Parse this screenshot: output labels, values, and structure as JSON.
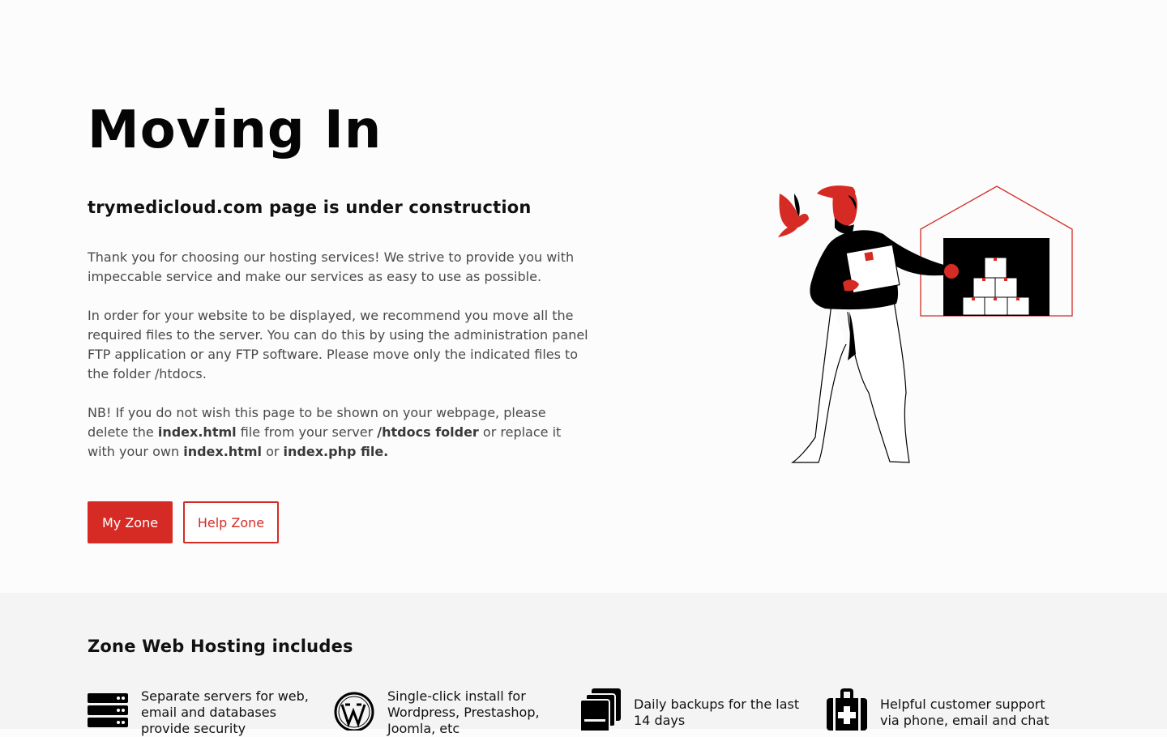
{
  "hero": {
    "title": "Moving In",
    "subtitle": "trymedicloud.com page is under construction",
    "paragraph1": "Thank you for choosing our hosting services! We strive to provide you with impeccable service and make our services as easy to use as possible.",
    "paragraph2": "In order for your website to be displayed, we recommend you move all the required files to the server. You can do this by using the administration panel FTP application or any FTP software. Please move only the indicated files to the folder /htdocs.",
    "paragraph3": {
      "part1": "NB! If you do not wish this page to be shown on your webpage, please delete the ",
      "bold1": "index.html",
      "part2": " file from your server ",
      "bold2": "/htdocs folder",
      "part3": " or replace it with your own ",
      "bold3": "index.html",
      "part4": " or ",
      "bold4": "index.php file."
    },
    "buttons": {
      "primary_label": "My Zone",
      "secondary_label": "Help Zone"
    },
    "illustration_icon": "mover-with-box-warehouse-illustration"
  },
  "features": {
    "title": "Zone Web Hosting includes",
    "items": [
      {
        "icon": "server-stack-icon",
        "text": "Separate servers for web, email and databases provide security"
      },
      {
        "icon": "wordpress-icon",
        "text": "Single-click install for Wordpress, Prestashop, Joomla, etc"
      },
      {
        "icon": "backup-copies-icon",
        "text": "Daily backups for the last 14 days"
      },
      {
        "icon": "first-aid-kit-icon",
        "text": "Helpful customer support via phone, email and chat"
      }
    ]
  },
  "colors": {
    "accent": "#d52b24",
    "features_bg": "#f4f4f4",
    "page_bg": "#fcfcfc"
  }
}
